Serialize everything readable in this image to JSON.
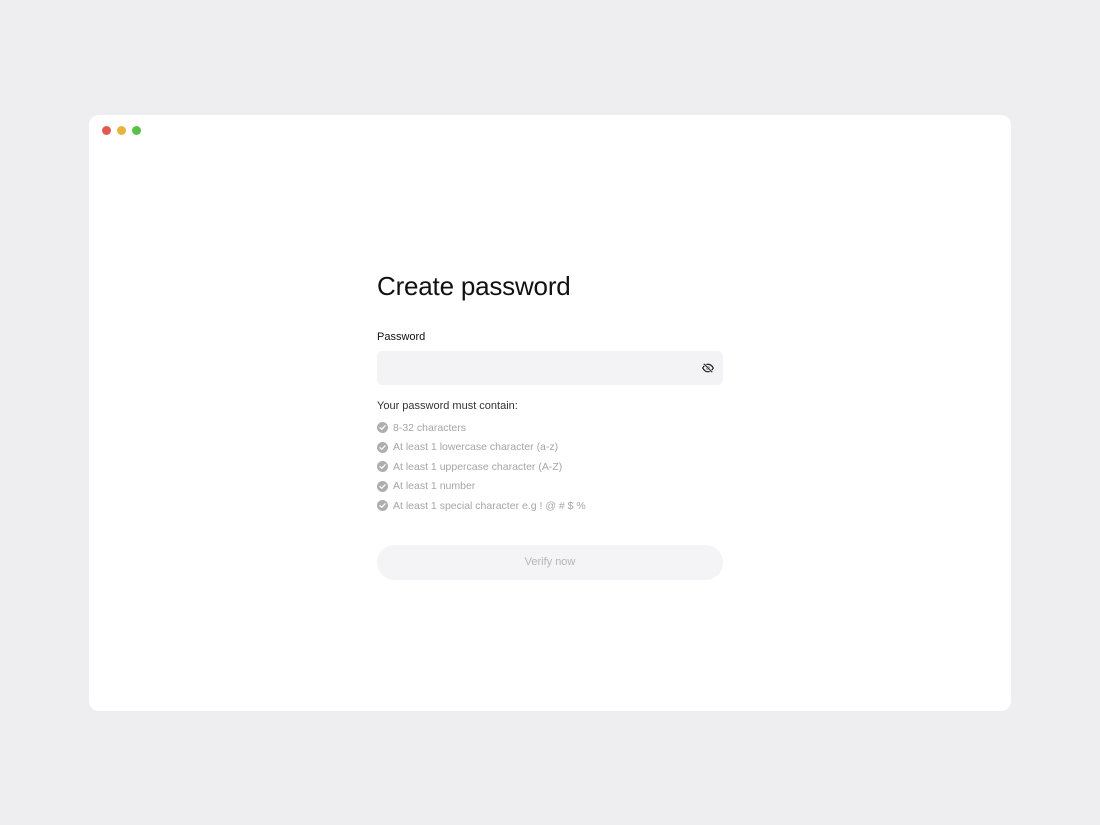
{
  "window": {
    "controls": [
      "close",
      "minimize",
      "maximize"
    ]
  },
  "form": {
    "title": "Create password",
    "password_label": "Password",
    "password_value": "",
    "toggle_icon": "eye-off-icon",
    "requirements_title": "Your password must contain:",
    "requirements": [
      "8-32 characters",
      "At least 1 lowercase character (a-z)",
      "At least 1 uppercase character (A-Z)",
      "At least 1 number",
      "At least 1 special character e.g ! @ # $ %"
    ],
    "submit_label": "Verify now"
  },
  "colors": {
    "background": "#eeedef",
    "window": "#ffffff",
    "input_bg": "#f3f2f5",
    "requirement_text": "#a5a4aa",
    "check_icon": "#aeadb2",
    "button_bg": "#f4f3f5",
    "button_text": "#b5b4b9",
    "close": "#e05a52",
    "minimize": "#e8b53c",
    "maximize": "#58c146"
  }
}
